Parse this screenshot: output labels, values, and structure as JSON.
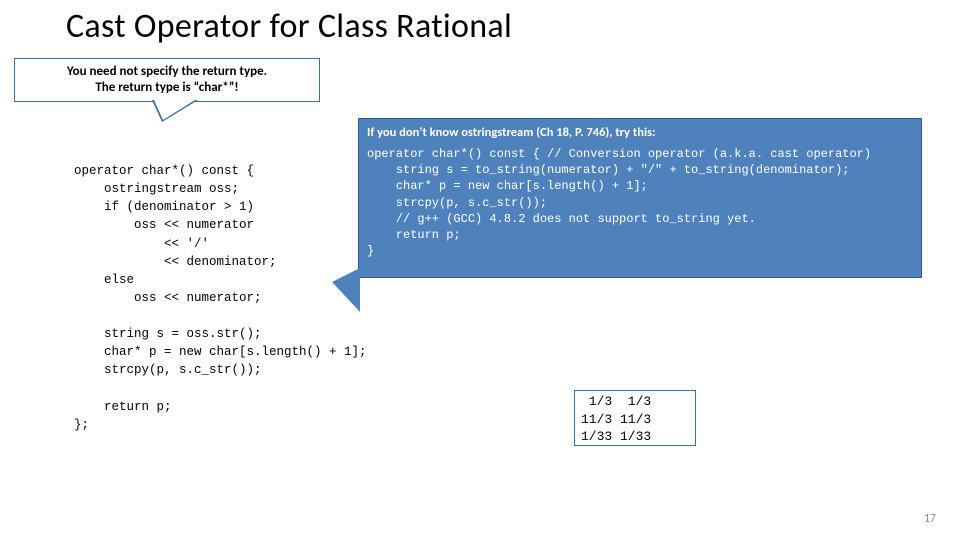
{
  "title": "Cast Operator for Class Rational",
  "note": {
    "line1": "You need not specify the return type.",
    "line2": "The return type is “char*”!"
  },
  "right": {
    "header": "If you don’t know ostringstream (Ch 18, P. 746), try this:",
    "code": "operator char*() const { // Conversion operator (a.k.a. cast operator)\n    string s = to_string(numerator) + \"/\" + to_string(denominator);\n    char* p = new char[s.length() + 1];\n    strcpy(p, s.c_str());\n    // g++ (GCC) 4.8.2 does not support to_string yet.\n    return p;\n}"
  },
  "main_code": "operator char*() const {\n    ostringstream oss;\n    if (denominator > 1)\n        oss << numerator\n            << '/'\n            << denominator;\n    else\n        oss << numerator;\n\n    string s = oss.str();\n    char* p = new char[s.length() + 1];\n    strcpy(p, s.c_str());\n\n    return p;\n};",
  "output": " 1/3  1/3\n11/3 11/3\n1/33 1/33",
  "pagenum": "17"
}
